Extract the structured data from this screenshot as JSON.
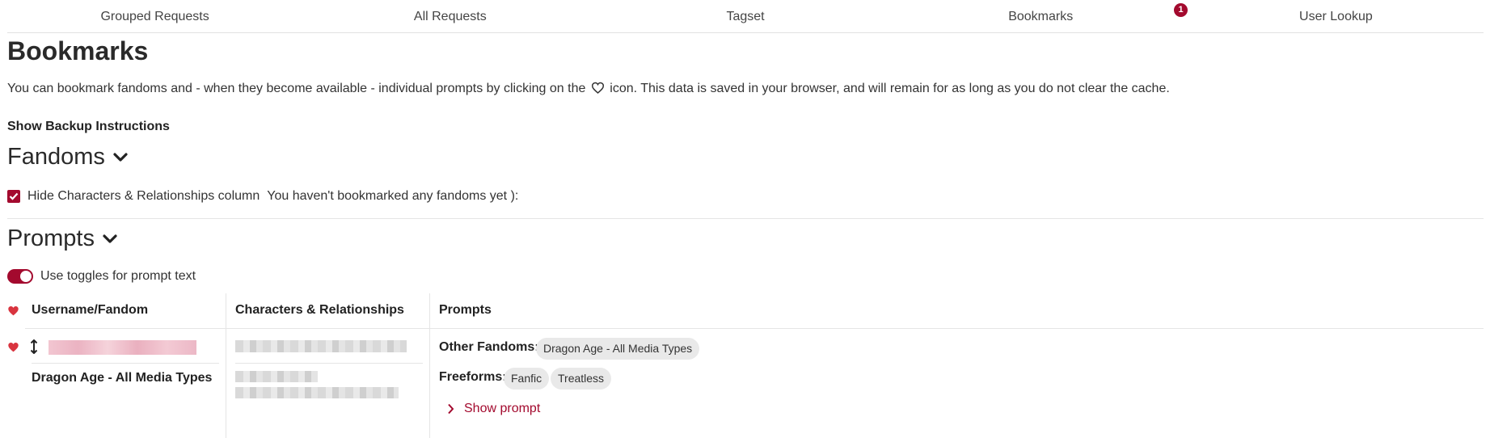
{
  "nav": {
    "items": [
      {
        "label": "Grouped Requests"
      },
      {
        "label": "All Requests"
      },
      {
        "label": "Tagset"
      },
      {
        "label": "Bookmarks"
      },
      {
        "label": "User Lookup"
      }
    ],
    "badge": "1"
  },
  "page": {
    "title": "Bookmarks",
    "intro_before": "You can bookmark fandoms and - when they become available - individual prompts by clicking on the",
    "intro_after": "icon. This data is saved in your browser, and will remain for as long as you do not clear the cache.",
    "backup_link": "Show Backup Instructions"
  },
  "fandoms": {
    "heading": "Fandoms",
    "checkbox_label": "Hide Characters & Relationships column",
    "empty_message": "You haven't bookmarked any fandoms yet ):",
    "checked": true
  },
  "prompts": {
    "heading": "Prompts",
    "toggle_label": "Use toggles for prompt text",
    "toggle_on": true,
    "columns": [
      "Username/Fandom",
      "Characters & Relationships",
      "Prompts"
    ],
    "row": {
      "fandom": "Dragon Age - All Media Types",
      "other_fandoms_label": "Other Fandoms:",
      "other_fandoms": [
        "Dragon Age - All Media Types"
      ],
      "freeforms_label": "Freeforms:",
      "freeforms": [
        "Fanfic",
        "Treatless"
      ],
      "show_prompt": "Show prompt"
    }
  },
  "colors": {
    "accent": "#a30a2e",
    "heart": "#d9343f"
  }
}
